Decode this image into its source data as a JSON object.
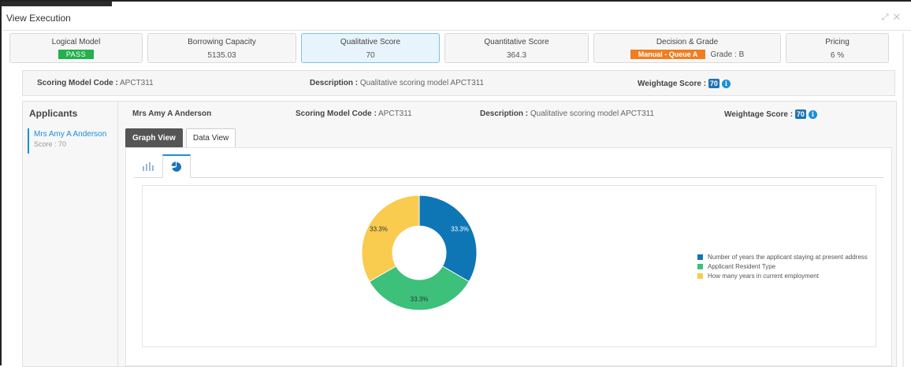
{
  "window": {
    "title": "View Execution",
    "controls": [
      "expand-icon",
      "close-icon"
    ]
  },
  "stages": [
    {
      "label": "Logical Model",
      "value": "PASS",
      "type": "badge-pass"
    },
    {
      "label": "Borrowing Capacity",
      "value": "5135.03",
      "type": "text"
    },
    {
      "label": "Qualitative Score",
      "value": "70",
      "type": "text",
      "active": true
    },
    {
      "label": "Quantitative Score",
      "value": "364.3",
      "type": "text"
    },
    {
      "label": "Decision & Grade",
      "value": "Manual - Queue A",
      "grade": "Grade : B",
      "type": "badge-queue"
    },
    {
      "label": "Pricing",
      "value": "6 %",
      "type": "text"
    }
  ],
  "summary": {
    "model_code_key": "Scoring Model Code :",
    "model_code_val": "APCT311",
    "desc_key": "Description :",
    "desc_val": "Qualitative scoring model APCT311",
    "weight_key": "Weightage Score :",
    "weight_val": "70"
  },
  "applicants": {
    "title": "Applicants",
    "items": [
      {
        "name": "Mrs Amy A Anderson",
        "score": "Score : 70"
      }
    ]
  },
  "detail": {
    "applicant": "Mrs Amy A Anderson",
    "model_code_key": "Scoring Model Code :",
    "model_code_val": "APCT311",
    "desc_key": "Description :",
    "desc_val": "Qualitative scoring model APCT311",
    "weight_key": "Weightage Score :",
    "weight_val": "70"
  },
  "view_tabs": [
    {
      "label": "Graph View",
      "active": true
    },
    {
      "label": "Data View",
      "active": false
    }
  ],
  "chart_icons": [
    "bar-chart-icon",
    "pie-chart-icon"
  ],
  "chart_data": {
    "type": "pie",
    "donut": true,
    "title": "",
    "series": [
      {
        "name": "Number of years the applicant staying at present address",
        "value": 33.3,
        "label": "33.3%",
        "color": "#0f76b6"
      },
      {
        "name": "Applicant Resident Type",
        "value": 33.3,
        "label": "33.3%",
        "color": "#3cc07a"
      },
      {
        "name": "How many years in current employment",
        "value": 33.3,
        "label": "33.3%",
        "color": "#f9cb4f"
      }
    ],
    "legend_position": "right"
  }
}
